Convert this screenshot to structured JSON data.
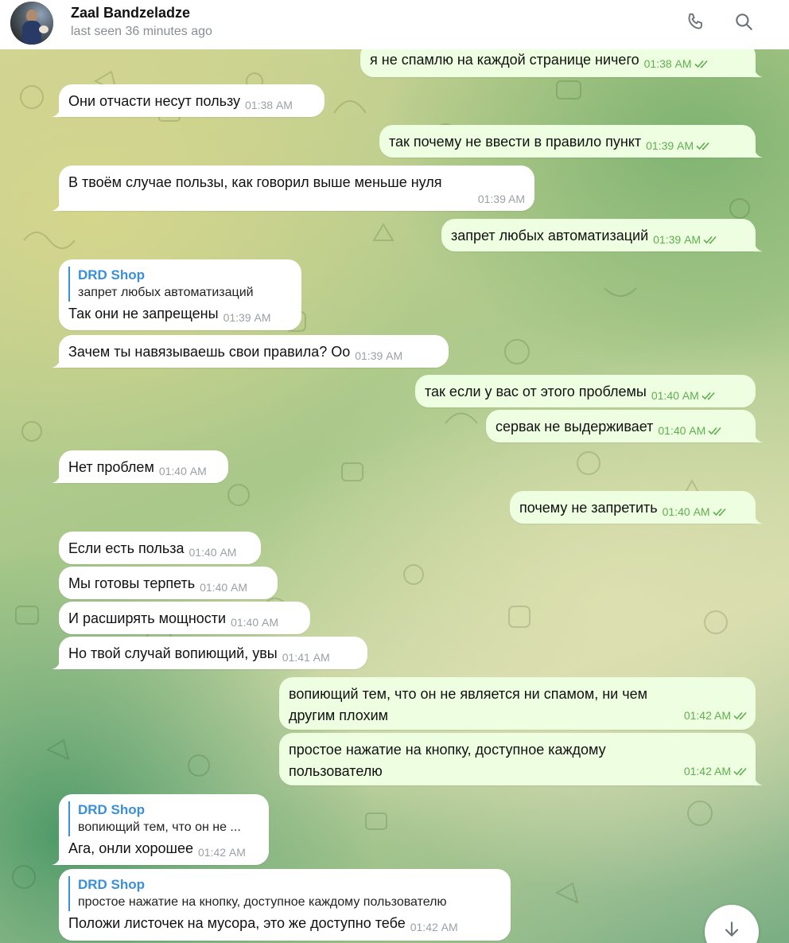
{
  "header": {
    "contact_name": "Zaal Bandzeladze",
    "status": "last seen 36 minutes ago",
    "icons": [
      "phone-icon",
      "search-icon"
    ]
  },
  "messages": [
    {
      "dir": "out",
      "text": "я не спамлю на каждой странице ничего",
      "time": "01:38 AM"
    },
    {
      "dir": "in",
      "text": "Они отчасти несут пользу",
      "time": "01:38 AM"
    },
    {
      "dir": "out",
      "text": "так почему не ввести в правило пункт",
      "time": "01:39 AM"
    },
    {
      "dir": "in",
      "text": "В твоём случае пользы, как говорил выше меньше нуля",
      "time": "01:39 AM"
    },
    {
      "dir": "out",
      "text": "запрет любых автоматизаций",
      "time": "01:39 AM"
    },
    {
      "dir": "in",
      "reply_name": "DRD Shop",
      "reply_text": "запрет любых автоматизаций",
      "text": "Так они не запрещены",
      "time": "01:39 AM"
    },
    {
      "dir": "in",
      "text": "Зачем ты навязываешь свои правила? Оо",
      "time": "01:39 AM"
    },
    {
      "dir": "out",
      "text": "так если у вас от этого проблемы",
      "time": "01:40 AM"
    },
    {
      "dir": "out",
      "text": "сервак не выдерживает",
      "time": "01:40 AM"
    },
    {
      "dir": "in",
      "text": "Нет проблем",
      "time": "01:40 AM"
    },
    {
      "dir": "out",
      "text": "почему не запретить",
      "time": "01:40 AM"
    },
    {
      "dir": "in",
      "text": "Если есть польза",
      "time": "01:40 AM"
    },
    {
      "dir": "in",
      "text": "Мы готовы терпеть",
      "time": "01:40 AM"
    },
    {
      "dir": "in",
      "text": "И расширять мощности",
      "time": "01:40 AM"
    },
    {
      "dir": "in",
      "text": "Но твой случай вопиющий, увы",
      "time": "01:41 AM"
    },
    {
      "dir": "out",
      "text_lines": [
        "вопиющий тем, что он не является ни спамом, ни чем",
        "другим плохим"
      ],
      "time": "01:42 AM"
    },
    {
      "dir": "out",
      "text_lines": [
        "простое нажатие на кнопку, доступное каждому",
        "пользователю"
      ],
      "time": "01:42 AM"
    },
    {
      "dir": "in",
      "reply_name": "DRD Shop",
      "reply_text": "вопиющий тем, что он не ...",
      "text": "Ага, онли хорошее",
      "time": "01:42 AM"
    },
    {
      "dir": "in",
      "reply_name": "DRD Shop",
      "reply_text": "простое нажатие на кнопку, доступное каждому пользователю",
      "text": "Положи листочек на мусора, это же доступно тебе",
      "time": "01:42 AM"
    }
  ],
  "colors": {
    "incoming_bubble": "#ffffff",
    "outgoing_bubble": "#eefee0",
    "outgoing_time": "#5fae4f",
    "reply_accent": "#3a8fd8"
  },
  "scroll_button_icon": "arrow-down-icon"
}
